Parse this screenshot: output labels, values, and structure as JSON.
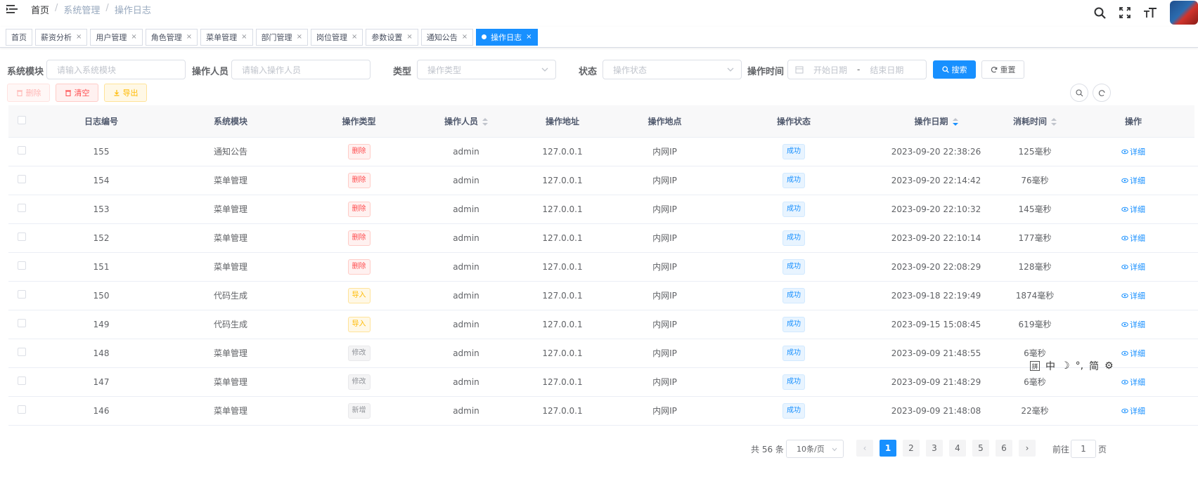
{
  "breadcrumb": [
    "首页",
    "系统管理",
    "操作日志"
  ],
  "breadcrumb_sep": "/",
  "tags": [
    {
      "label": "首页",
      "closable": false
    },
    {
      "label": "薪资分析",
      "closable": true
    },
    {
      "label": "用户管理",
      "closable": true
    },
    {
      "label": "角色管理",
      "closable": true
    },
    {
      "label": "菜单管理",
      "closable": true
    },
    {
      "label": "部门管理",
      "closable": true
    },
    {
      "label": "岗位管理",
      "closable": true
    },
    {
      "label": "参数设置",
      "closable": true
    },
    {
      "label": "通知公告",
      "closable": true
    },
    {
      "label": "操作日志",
      "closable": true,
      "active": true
    }
  ],
  "tag_close": "×",
  "filters": {
    "module_label": "系统模块",
    "module_placeholder": "请输入系统模块",
    "operator_label": "操作人员",
    "operator_placeholder": "请输入操作人员",
    "type_label": "类型",
    "type_placeholder": "操作类型",
    "status_label": "状态",
    "status_placeholder": "操作状态",
    "time_label": "操作时间",
    "start_placeholder": "开始日期",
    "range_sep": "-",
    "end_placeholder": "结束日期",
    "search_button": "搜索",
    "reset_button": "重置"
  },
  "toolbar": {
    "delete_button": "删除",
    "clear_button": "清空",
    "export_button": "导出"
  },
  "table": {
    "columns": [
      "日志编号",
      "系统模块",
      "操作类型",
      "操作人员",
      "操作地址",
      "操作地点",
      "操作状态",
      "操作日期",
      "消耗时间",
      "操作"
    ],
    "detail_label": "详细",
    "rows": [
      {
        "id": "155",
        "module": "通知公告",
        "type": "删除",
        "type_style": "danger",
        "operator": "admin",
        "ip": "127.0.0.1",
        "location": "内网IP",
        "status": "成功",
        "date": "2023-09-20 22:38:26",
        "cost": "125毫秒"
      },
      {
        "id": "154",
        "module": "菜单管理",
        "type": "删除",
        "type_style": "danger",
        "operator": "admin",
        "ip": "127.0.0.1",
        "location": "内网IP",
        "status": "成功",
        "date": "2023-09-20 22:14:42",
        "cost": "76毫秒"
      },
      {
        "id": "153",
        "module": "菜单管理",
        "type": "删除",
        "type_style": "danger",
        "operator": "admin",
        "ip": "127.0.0.1",
        "location": "内网IP",
        "status": "成功",
        "date": "2023-09-20 22:10:32",
        "cost": "145毫秒"
      },
      {
        "id": "152",
        "module": "菜单管理",
        "type": "删除",
        "type_style": "danger",
        "operator": "admin",
        "ip": "127.0.0.1",
        "location": "内网IP",
        "status": "成功",
        "date": "2023-09-20 22:10:14",
        "cost": "177毫秒"
      },
      {
        "id": "151",
        "module": "菜单管理",
        "type": "删除",
        "type_style": "danger",
        "operator": "admin",
        "ip": "127.0.0.1",
        "location": "内网IP",
        "status": "成功",
        "date": "2023-09-20 22:08:29",
        "cost": "128毫秒"
      },
      {
        "id": "150",
        "module": "代码生成",
        "type": "导入",
        "type_style": "warning",
        "operator": "admin",
        "ip": "127.0.0.1",
        "location": "内网IP",
        "status": "成功",
        "date": "2023-09-18 22:19:49",
        "cost": "1874毫秒"
      },
      {
        "id": "149",
        "module": "代码生成",
        "type": "导入",
        "type_style": "warning",
        "operator": "admin",
        "ip": "127.0.0.1",
        "location": "内网IP",
        "status": "成功",
        "date": "2023-09-15 15:08:45",
        "cost": "619毫秒"
      },
      {
        "id": "148",
        "module": "菜单管理",
        "type": "修改",
        "type_style": "info",
        "operator": "admin",
        "ip": "127.0.0.1",
        "location": "内网IP",
        "status": "成功",
        "date": "2023-09-09 21:48:55",
        "cost": "6毫秒"
      },
      {
        "id": "147",
        "module": "菜单管理",
        "type": "修改",
        "type_style": "info",
        "operator": "admin",
        "ip": "127.0.0.1",
        "location": "内网IP",
        "status": "成功",
        "date": "2023-09-09 21:48:29",
        "cost": "6毫秒"
      },
      {
        "id": "146",
        "module": "菜单管理",
        "type": "新增",
        "type_style": "info",
        "operator": "admin",
        "ip": "127.0.0.1",
        "location": "内网IP",
        "status": "成功",
        "date": "2023-09-09 21:48:08",
        "cost": "22毫秒"
      }
    ]
  },
  "pagination": {
    "total_text": "共 56 条",
    "page_size": "10条/页",
    "pages": [
      "1",
      "2",
      "3",
      "4",
      "5",
      "6"
    ],
    "current": "1",
    "goto_label": "前往",
    "goto_value": "1",
    "goto_tail": "页"
  },
  "ime_bar": {
    "box": "拼",
    "items": [
      "中",
      "☽",
      "°,",
      "简",
      "⚙"
    ]
  },
  "colors": {
    "primary": "#1890ff",
    "danger": "#ff4d4f",
    "warning": "#ffba00",
    "info": "#909399"
  }
}
